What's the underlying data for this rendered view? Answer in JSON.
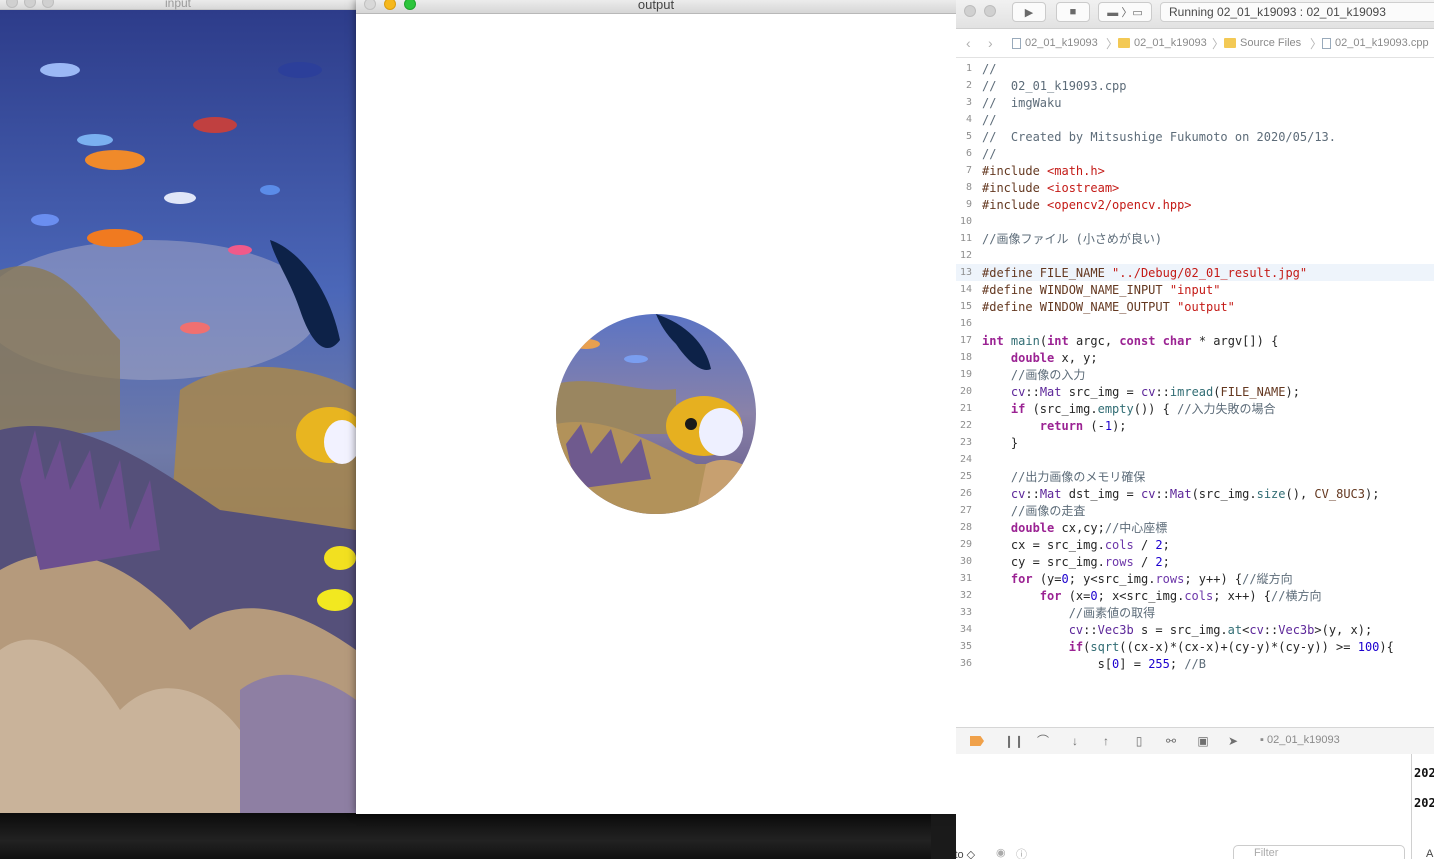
{
  "input_window": {
    "title": "input"
  },
  "output_window": {
    "title": "output"
  },
  "ide": {
    "status": "Running 02_01_k19093 : 02_01_k19093",
    "breadcrumbs": [
      "02_01_k19093",
      "02_01_k19093",
      "Source Files",
      "02_01_k19093.cpp"
    ],
    "highlight_line": 13,
    "code": [
      {
        "n": "1",
        "t": "//",
        "c": "com"
      },
      {
        "n": "2",
        "t": "//  02_01_k19093.cpp",
        "c": "com"
      },
      {
        "n": "3",
        "t": "//  imgWaku",
        "c": "com"
      },
      {
        "n": "4",
        "t": "//",
        "c": "com"
      },
      {
        "n": "5",
        "t": "//  Created by Mitsushige Fukumoto on 2020/05/13.",
        "c": "com"
      },
      {
        "n": "6",
        "t": "//",
        "c": "com"
      },
      {
        "n": "7",
        "t": "#include <math.h>",
        "c": "inc"
      },
      {
        "n": "8",
        "t": "#include <iostream>",
        "c": "inc"
      },
      {
        "n": "9",
        "t": "#include <opencv2/opencv.hpp>",
        "c": "inc"
      },
      {
        "n": "10",
        "t": "",
        "c": ""
      },
      {
        "n": "11",
        "t": "//画像ファイル (小さめが良い)",
        "c": "com"
      },
      {
        "n": "12",
        "t": "",
        "c": ""
      },
      {
        "n": "13",
        "t": "#define FILE_NAME \"../Debug/02_01_result.jpg\"",
        "c": "def"
      },
      {
        "n": "14",
        "t": "#define WINDOW_NAME_INPUT \"input\"",
        "c": "def"
      },
      {
        "n": "15",
        "t": "#define WINDOW_NAME_OUTPUT \"output\"",
        "c": "def"
      },
      {
        "n": "16",
        "t": "",
        "c": ""
      },
      {
        "n": "17",
        "t": "int main(int argc, const char * argv[]) {",
        "c": "code"
      },
      {
        "n": "18",
        "t": "    double x, y;",
        "c": "code"
      },
      {
        "n": "19",
        "t": "    //画像の入力",
        "c": "com"
      },
      {
        "n": "20",
        "t": "    cv::Mat src_img = cv::imread(FILE_NAME);",
        "c": "code"
      },
      {
        "n": "21",
        "t": "    if (src_img.empty()) { //入力失敗の場合",
        "c": "code"
      },
      {
        "n": "22",
        "t": "        return (-1);",
        "c": "code"
      },
      {
        "n": "23",
        "t": "    }",
        "c": "code"
      },
      {
        "n": "24",
        "t": "",
        "c": ""
      },
      {
        "n": "25",
        "t": "    //出力画像のメモリ確保",
        "c": "com"
      },
      {
        "n": "26",
        "t": "    cv::Mat dst_img = cv::Mat(src_img.size(), CV_8UC3);",
        "c": "code"
      },
      {
        "n": "27",
        "t": "    //画像の走査",
        "c": "com"
      },
      {
        "n": "28",
        "t": "    double cx,cy;//中心座標",
        "c": "code"
      },
      {
        "n": "29",
        "t": "    cx = src_img.cols / 2;",
        "c": "code"
      },
      {
        "n": "30",
        "t": "    cy = src_img.rows / 2;",
        "c": "code"
      },
      {
        "n": "31",
        "t": "    for (y=0; y<src_img.rows; y++) {//縦方向",
        "c": "code"
      },
      {
        "n": "32",
        "t": "        for (x=0; x<src_img.cols; x++) {//横方向",
        "c": "code"
      },
      {
        "n": "33",
        "t": "            //画素値の取得",
        "c": "com"
      },
      {
        "n": "34",
        "t": "            cv::Vec3b s = src_img.at<cv::Vec3b>(y, x);",
        "c": "code"
      },
      {
        "n": "35",
        "t": "            if(sqrt((cx-x)*(cx-x)+(cy-y)*(cy-y)) >= 100){",
        "c": "code"
      },
      {
        "n": "36",
        "t": "                s[0] = 255; //B",
        "c": "code"
      }
    ],
    "debug_target": "02_01_k19093",
    "console_lines": [
      "202",
      "202"
    ],
    "bottom": {
      "auto_label": "Auto ◇",
      "filter_placeholder": "Filter",
      "all_label": "All"
    }
  },
  "colors": {
    "accent": "#f0a14a",
    "highlight": "#eef4fb"
  }
}
